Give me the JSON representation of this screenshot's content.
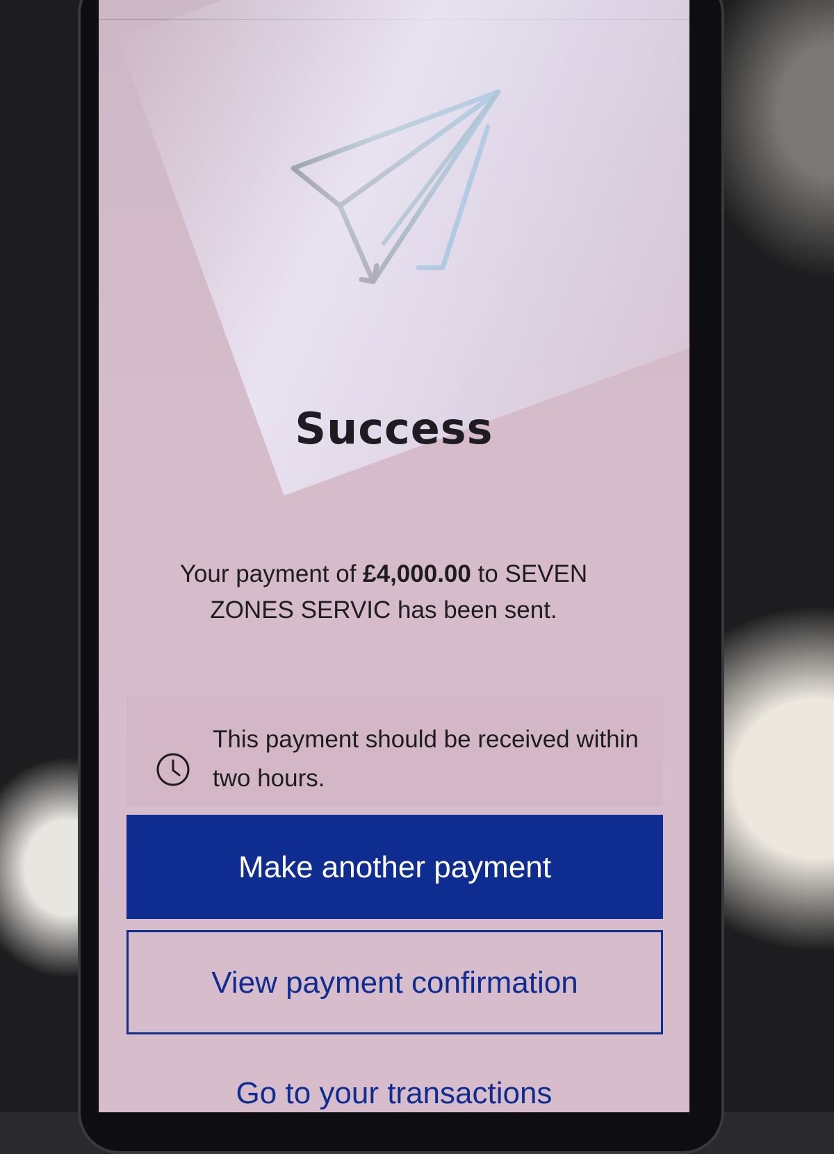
{
  "success": {
    "icon": "paper-plane-icon",
    "title": "Success",
    "message_prefix": "Your payment of ",
    "amount": "£4,000.00",
    "message_middle": " to ",
    "payee": "SEVEN ZONES SERVIC",
    "message_suffix": " has been sent."
  },
  "info": {
    "icon": "clock-icon",
    "text": "This payment should be received within two hours."
  },
  "actions": {
    "primary_label": "Make another payment",
    "secondary_label": "View payment confirmation",
    "link_label": "Go to your transactions"
  },
  "colors": {
    "accent": "#0f2c90",
    "screen_background": "#d7bdcc",
    "text": "#1e1c22"
  }
}
